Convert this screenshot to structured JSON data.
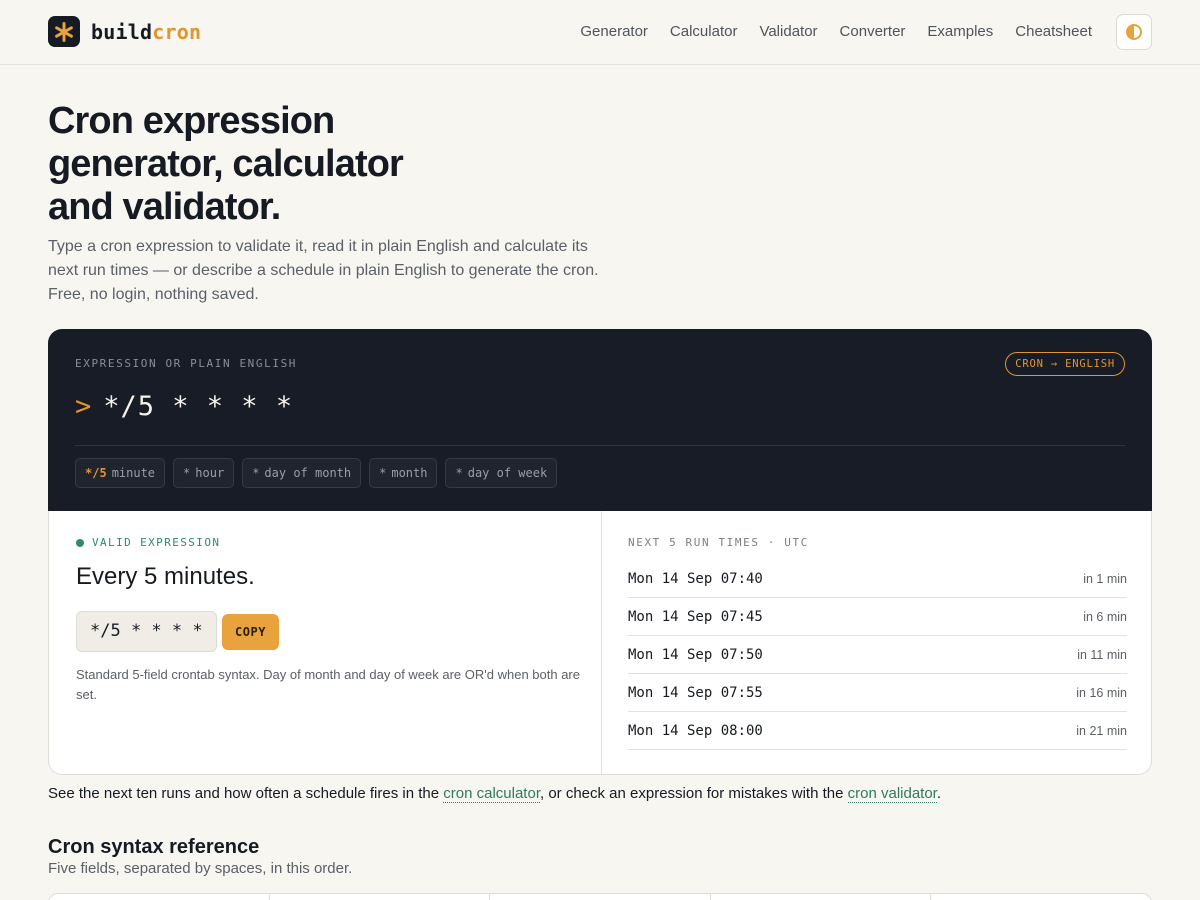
{
  "brand": {
    "name_part1": "build",
    "name_part2": "cron",
    "accent": "#e0962e"
  },
  "nav": {
    "links": [
      "Generator",
      "Calculator",
      "Validator",
      "Converter",
      "Examples",
      "Cheatsheet"
    ],
    "theme_icon": "half-circle-icon"
  },
  "hero": {
    "title": "Cron expression generator, calculator and validator.",
    "subtitle": "Type a cron expression to validate it, read it in plain English and calculate its next run times — or describe a schedule in plain English to generate the cron. Free, no login, nothing saved."
  },
  "editor": {
    "label": "EXPRESSION OR PLAIN ENGLISH",
    "mode_badge": "CRON → ENGLISH",
    "prompt": ">",
    "expression": "*/5 * * * *",
    "fields": [
      {
        "value": "*/5",
        "name": "minute",
        "highlighted": true
      },
      {
        "value": "*",
        "name": "hour",
        "highlighted": false
      },
      {
        "value": "*",
        "name": "day of month",
        "highlighted": false
      },
      {
        "value": "*",
        "name": "month",
        "highlighted": false
      },
      {
        "value": "*",
        "name": "day of week",
        "highlighted": false
      }
    ]
  },
  "result": {
    "status": "VALID EXPRESSION",
    "status_color": "#2f8a6e",
    "description": "Every 5 minutes.",
    "expression": "*/5 * * * *",
    "copy_label": "COPY",
    "note": "Standard 5-field crontab syntax. Day of month and day of week are OR'd when both are set."
  },
  "runs": {
    "label": "NEXT 5 RUN TIMES · UTC",
    "items": [
      {
        "time": "Mon 14 Sep 07:40",
        "relative": "in 1 min"
      },
      {
        "time": "Mon 14 Sep 07:45",
        "relative": "in 6 min"
      },
      {
        "time": "Mon 14 Sep 07:50",
        "relative": "in 11 min"
      },
      {
        "time": "Mon 14 Sep 07:55",
        "relative": "in 16 min"
      },
      {
        "time": "Mon 14 Sep 08:00",
        "relative": "in 21 min"
      }
    ]
  },
  "see_also": {
    "text_before": "See the next ten runs and how often a schedule fires in the ",
    "link1": "cron calculator",
    "text_middle": ", or check an expression for mistakes with the ",
    "link2": "cron validator",
    "text_after": "."
  },
  "reference": {
    "title": "Cron syntax reference",
    "subtitle": "Five fields, separated by spaces, in this order."
  }
}
